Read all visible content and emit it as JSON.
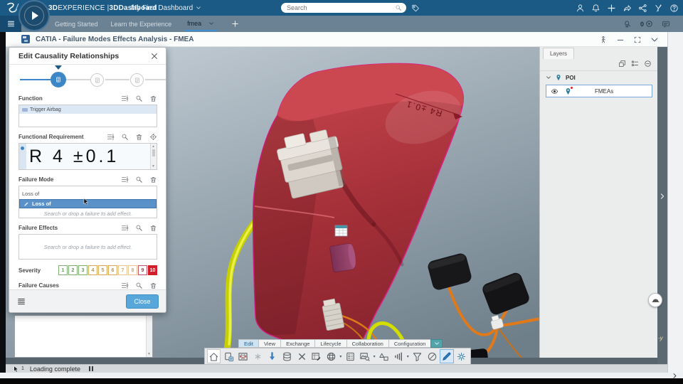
{
  "colors": {
    "topbar": "#1b5a84",
    "tabbar": "#6a8294",
    "accent": "#3d87c6",
    "closebtn": "#57a7da",
    "sevred": "#d01f2a",
    "tbactive": "#cfe4f2",
    "selection_pink": "#dc2086",
    "viewport_top": "#c9d2d9",
    "viewport_bottom": "#6e7f8a"
  },
  "top_bar": {
    "brand_parts": [
      "3D",
      "EXPERIENCE | ",
      "3DDashboard"
    ],
    "dashboard_name": "My First Dashboard",
    "search_placeholder": "Search",
    "icons": [
      "tag",
      "user",
      "notifications",
      "add",
      "forward",
      "share",
      "swym",
      "help"
    ]
  },
  "tab_bar": {
    "tabs": [
      "Getting Started",
      "Learn the Experience",
      "fmea"
    ],
    "active_tab": "fmea",
    "media_count": "0",
    "icons": [
      "ribbon-search",
      "play-circle",
      "chat"
    ]
  },
  "app_window": {
    "title": "CATIA - Failure Modes Effects Analysis - FMEA",
    "controls": [
      "assistant",
      "minimize",
      "expand",
      "collapse"
    ]
  },
  "dialog": {
    "title": "Edit Causality Relationships",
    "steps": 3,
    "active_step": 1,
    "function": {
      "label": "Function",
      "item": "Trigger Airbag"
    },
    "functional_requirement": {
      "label": "Functional Requirement",
      "value": "R 4 ±0.1"
    },
    "failure_mode": {
      "label": "Failure Mode",
      "input_value": "Loss of",
      "suggestion": "Loss of",
      "placeholder": "Search or drop a failure to add effect."
    },
    "failure_effects": {
      "label": "Failure Effects",
      "placeholder": "Search or drop a failure to add effect."
    },
    "severity": {
      "label": "Severity",
      "scale": [
        {
          "v": "1",
          "t": "g"
        },
        {
          "v": "2",
          "t": "g"
        },
        {
          "v": "3",
          "t": "g"
        },
        {
          "v": "4",
          "t": "a"
        },
        {
          "v": "5",
          "t": "a"
        },
        {
          "v": "6",
          "t": "a"
        },
        {
          "v": "7",
          "t": "o"
        },
        {
          "v": "8",
          "t": "o"
        },
        {
          "v": "9",
          "t": "r"
        },
        {
          "v": "10",
          "t": "f"
        }
      ]
    },
    "failure_causes": {
      "label": "Failure Causes"
    },
    "close_label": "Close"
  },
  "layers_panel": {
    "tab": "Layers",
    "tools": [
      "layer-new",
      "layer-list",
      "minus-circle"
    ],
    "group": "POI",
    "item": "FMEAs"
  },
  "action_bar": {
    "tabs": [
      "Edit",
      "View",
      "Exchange",
      "Lifecycle",
      "Collaboration",
      "Configuration"
    ],
    "active_tab": "Edit",
    "icons": [
      "home",
      "new-window",
      "planning",
      "asterisk",
      "import",
      "database",
      "delete",
      "sheet-pen",
      "globe",
      "form",
      "image-search",
      "shapes",
      "horn",
      "filter",
      "eraser",
      "pen",
      "gear"
    ]
  },
  "status_bar": {
    "selection_count": "1",
    "message": "Loading complete"
  },
  "viewport": {
    "annotation": "R4 ±0.1",
    "axis_label": "-y"
  }
}
